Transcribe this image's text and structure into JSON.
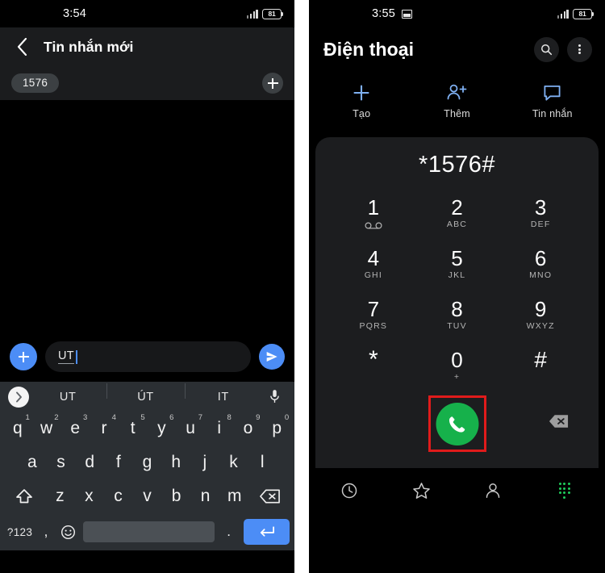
{
  "left_phone": {
    "status_bar": {
      "time": "3:54",
      "battery_level": "81",
      "signal_icon": "signal-bars-icon",
      "battery_icon": "battery-icon"
    },
    "app_bar": {
      "back_icon": "back-chevron-icon",
      "title": "Tin nhắn mới"
    },
    "recipients": {
      "chips": [
        "1576"
      ],
      "add_icon": "plus-icon"
    },
    "compose": {
      "attach_icon": "plus-icon",
      "text_value": "UT",
      "send_icon": "send-paper-plane-icon"
    },
    "keyboard": {
      "expand_icon": "chevron-right-icon",
      "suggestions": [
        "UT",
        "ÚT",
        "IT"
      ],
      "mic_icon": "microphone-icon",
      "row1": [
        {
          "letter": "q",
          "num": "1"
        },
        {
          "letter": "w",
          "num": "2"
        },
        {
          "letter": "e",
          "num": "3"
        },
        {
          "letter": "r",
          "num": "4"
        },
        {
          "letter": "t",
          "num": "5"
        },
        {
          "letter": "y",
          "num": "6"
        },
        {
          "letter": "u",
          "num": "7"
        },
        {
          "letter": "i",
          "num": "8"
        },
        {
          "letter": "o",
          "num": "9"
        },
        {
          "letter": "p",
          "num": "0"
        }
      ],
      "row2": [
        "a",
        "s",
        "d",
        "f",
        "g",
        "h",
        "j",
        "k",
        "l"
      ],
      "row3": [
        "z",
        "x",
        "c",
        "v",
        "b",
        "n",
        "m"
      ],
      "shift_icon": "shift-arrow-icon",
      "backspace_icon": "backspace-icon",
      "row4": {
        "symbols_label": "?123",
        "comma": ",",
        "emoji_icon": "emoji-smiley-icon",
        "space_label": "",
        "period": ".",
        "enter_icon": "enter-return-icon"
      }
    }
  },
  "right_phone": {
    "status_bar": {
      "time": "3:55",
      "notification_icon": "image-notification-icon",
      "battery_level": "81",
      "signal_icon": "signal-bars-icon",
      "battery_icon": "battery-icon"
    },
    "app_bar": {
      "title": "Điện thoại",
      "search_icon": "search-icon",
      "overflow_icon": "kebab-menu-icon"
    },
    "quick_actions": [
      {
        "icon": "plus-icon",
        "label": "Tạo"
      },
      {
        "icon": "person-add-icon",
        "label": "Thêm"
      },
      {
        "icon": "message-bubble-icon",
        "label": "Tin nhắn"
      }
    ],
    "dialpad": {
      "display_value": "*1576#",
      "keys": [
        {
          "num": "1",
          "sub": "",
          "voicemail": true
        },
        {
          "num": "2",
          "sub": "ABC"
        },
        {
          "num": "3",
          "sub": "DEF"
        },
        {
          "num": "4",
          "sub": "GHI"
        },
        {
          "num": "5",
          "sub": "JKL"
        },
        {
          "num": "6",
          "sub": "MNO"
        },
        {
          "num": "7",
          "sub": "PQRS"
        },
        {
          "num": "8",
          "sub": "TUV"
        },
        {
          "num": "9",
          "sub": "WXYZ"
        },
        {
          "num": "*",
          "sub": ""
        },
        {
          "num": "0",
          "sub": "+"
        },
        {
          "num": "#",
          "sub": ""
        }
      ],
      "call_icon": "phone-call-icon",
      "backspace_icon": "backspace-icon",
      "highlight_color": "#e01b1b",
      "call_button_color": "#16b14b"
    },
    "bottom_nav": [
      {
        "icon": "clock-recents-icon",
        "active": false
      },
      {
        "icon": "star-favorites-icon",
        "active": false
      },
      {
        "icon": "person-contacts-icon",
        "active": false
      },
      {
        "icon": "dialpad-icon",
        "active": true
      }
    ]
  }
}
